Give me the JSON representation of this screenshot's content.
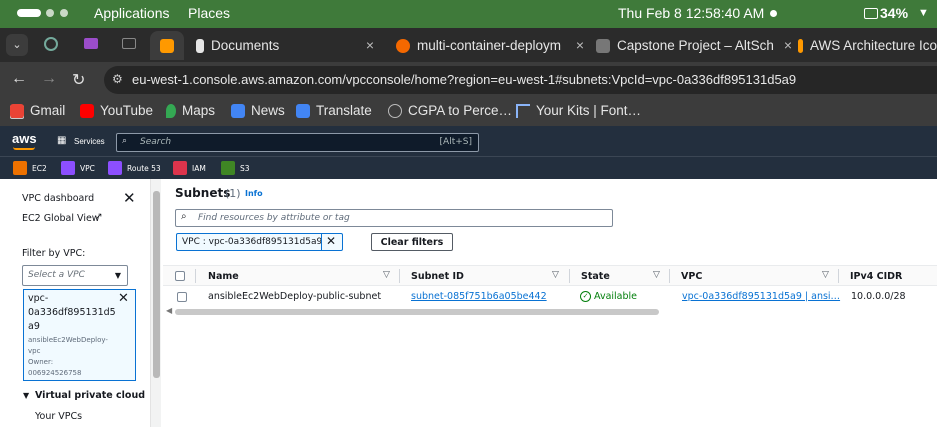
{
  "os_bar": {
    "applications": "Applications",
    "places": "Places",
    "datetime": "Thu Feb 8  12:58:40 AM",
    "battery": "34%"
  },
  "tabs": [
    {
      "label": "Documents"
    },
    {
      "label": "multi-container-deploym"
    },
    {
      "label": "Capstone Project – AltSch"
    },
    {
      "label": "AWS Architecture Ico"
    }
  ],
  "address_bar": {
    "url": "eu-west-1.console.aws.amazon.com/vpcconsole/home?region=eu-west-1#subnets:VpcId=vpc-0a336df895131d5a9"
  },
  "bookmarks": [
    {
      "label": "Gmail",
      "color": "#ea4335"
    },
    {
      "label": "YouTube",
      "color": "#ff0000"
    },
    {
      "label": "Maps",
      "color": "#34a853"
    },
    {
      "label": "News",
      "color": "#4285f4"
    },
    {
      "label": "Translate",
      "color": "#4285f4"
    },
    {
      "label": "CGPA to Perce…",
      "color": "#9aa0a6"
    },
    {
      "label": "Your Kits | Font…",
      "color": "#8ab4f8"
    }
  ],
  "aws_header": {
    "logo": "aws",
    "services": "Services",
    "search_placeholder": "Search",
    "search_shortcut": "[Alt+S]"
  },
  "favorites": [
    {
      "label": "EC2",
      "color": "#ed7100"
    },
    {
      "label": "VPC",
      "color": "#8c4fff"
    },
    {
      "label": "Route 53",
      "color": "#8c4fff"
    },
    {
      "label": "IAM",
      "color": "#dd344c"
    },
    {
      "label": "S3",
      "color": "#3f8624"
    }
  ],
  "left_nav": {
    "vpc_dashboard": "VPC dashboard",
    "ec2_global_view": "EC2 Global View",
    "filter_label": "Filter by VPC:",
    "select_placeholder": "Select a VPC",
    "selected_vpc": {
      "id_line1": "vpc-",
      "id_line2": "0a336df895131d5",
      "id_line3": "a9",
      "name_line1": "ansibleEc2WebDeploy-",
      "name_line2": "vpc",
      "owner_label": "Owner:",
      "owner_id": "006924526758"
    },
    "section_title": "Virtual private cloud",
    "your_vpcs": "Your VPCs"
  },
  "main": {
    "title": "Subnets",
    "count": "(1)",
    "info": "Info",
    "filter_placeholder": "Find resources by attribute or tag",
    "filter_token": "VPC : vpc-0a336df895131d5a9",
    "clear_filters": "Clear filters",
    "columns": [
      "Name",
      "Subnet ID",
      "State",
      "VPC",
      "IPv4 CIDR"
    ],
    "rows": [
      {
        "name": "ansibleEc2WebDeploy-public-subnet",
        "subnet_id": "subnet-085f751b6a05be442",
        "state": "Available",
        "vpc": "vpc-0a336df895131d5a9 | ansi…",
        "cidr": "10.0.0.0/28"
      }
    ]
  },
  "colors": {
    "aws_navy": "#232f3e",
    "link_blue": "#0972d3",
    "available_green": "#037f0c",
    "os_bar_green": "#3f7a3a"
  }
}
